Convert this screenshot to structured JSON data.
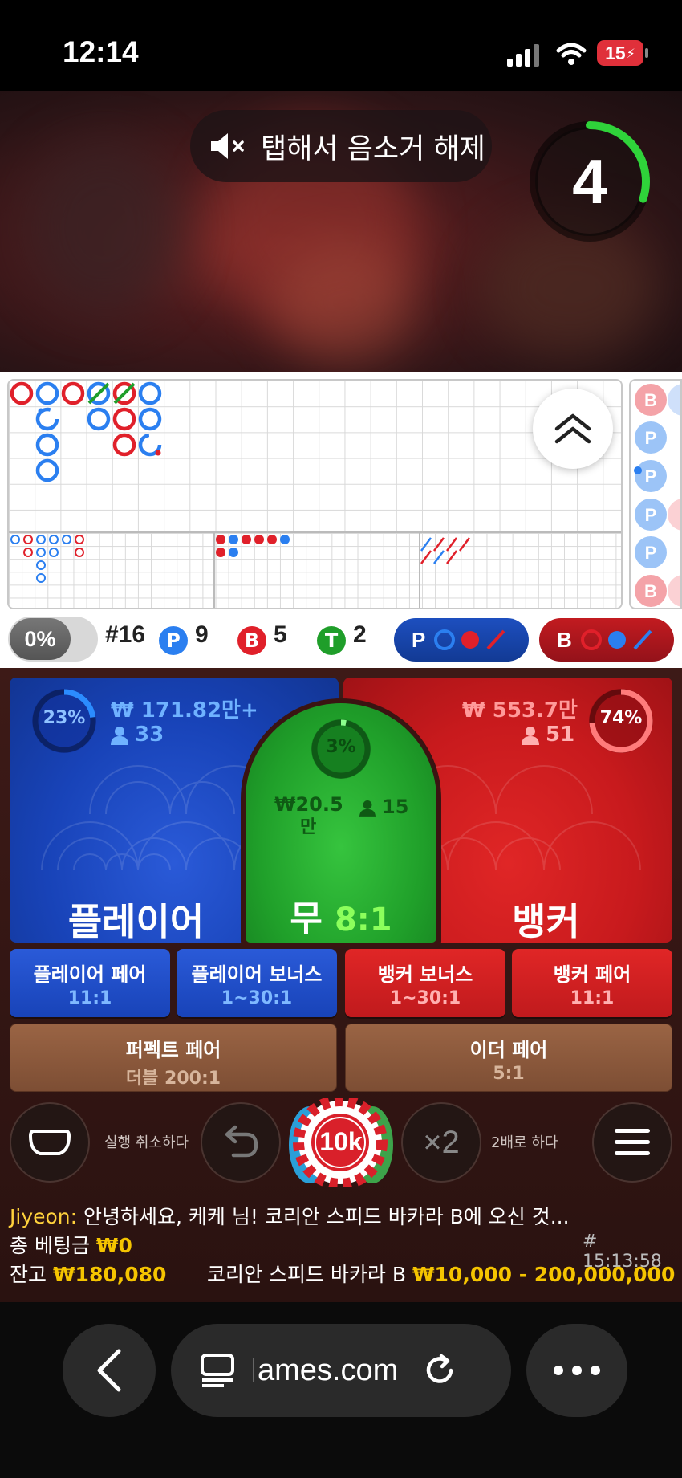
{
  "status_bar": {
    "time": "12:14",
    "battery": "15"
  },
  "video": {
    "mute_text": "탭해서 음소거 해제",
    "countdown": "4",
    "countdown_progress": 0.3
  },
  "stats": {
    "win_pct": "0%",
    "round": "#16",
    "player_letter": "P",
    "player_count": "9",
    "banker_letter": "B",
    "banker_count": "5",
    "tie_letter": "T",
    "tie_count": "2",
    "player_predict": "P",
    "banker_predict": "B"
  },
  "bets": {
    "player": {
      "pct": "23%",
      "pct_value": 23,
      "amount": "₩ 171.82만+",
      "users": "33",
      "label": "플레이어"
    },
    "tie": {
      "pct": "3%",
      "pct_value": 3,
      "amount": "₩20.5",
      "amount_unit": "만",
      "users": "15",
      "label": "무",
      "odds": "8:1"
    },
    "banker": {
      "pct": "74%",
      "pct_value": 74,
      "amount": "₩ 553.7만",
      "users": "51",
      "label": "뱅커"
    }
  },
  "side_bets": [
    {
      "title": "플레이어 페어",
      "odds": "11:1"
    },
    {
      "title": "플레이어 보너스",
      "odds": "1~30:1"
    },
    {
      "title": "뱅커 보너스",
      "odds": "1~30:1"
    },
    {
      "title": "뱅커 페어",
      "odds": "11:1"
    }
  ],
  "pair_bets": [
    {
      "title": "퍼펙트 페어",
      "odds": "더블 200:1"
    },
    {
      "title": "이더 페어",
      "odds": "5:1"
    }
  ],
  "controls": {
    "undo_label": "실행 취소하다",
    "chip_value": "10k",
    "double_symbol": "×2",
    "double_label": "2배로 하다"
  },
  "info": {
    "chat_user": "Jiyeon:",
    "chat_message": "안녕하세요, 케케 님! 코리안 스피드 바카라 B에 오신 것...",
    "total_bet_label": "총 베팅금",
    "total_bet_value": "₩0",
    "timestamp": "# 15:13:58",
    "balance_label": "잔고",
    "balance_value": "₩180,080",
    "table_name": "코리안 스피드 바카라 B",
    "table_limits": "₩10,000 - 200,000,000"
  },
  "browser": {
    "url": "ames.com"
  },
  "colors": {
    "player": "#1c4fd8",
    "banker": "#d81c1c",
    "tie": "#1f9e2a",
    "gold": "#f5c400"
  }
}
